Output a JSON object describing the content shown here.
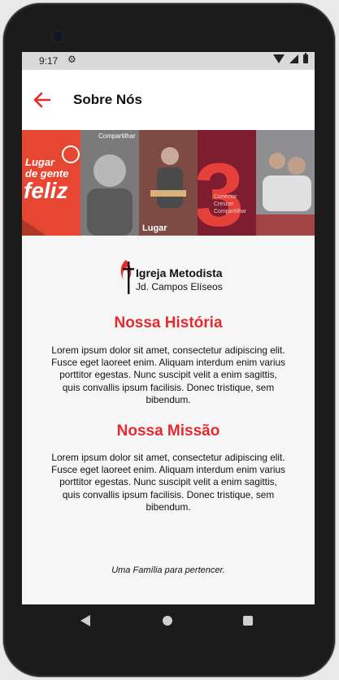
{
  "status_bar": {
    "time": "9:17",
    "settings_icon": "gear-icon"
  },
  "app_bar": {
    "title": "Sobre Nós",
    "back_icon": "arrow-left-icon",
    "accent": "#e62b2f"
  },
  "banner": {
    "texts": [
      "Lugar",
      "de gente",
      "feliz",
      "Compartilhar",
      "Conectar",
      "Crescer",
      "Compartilhar",
      "Lugar",
      "3"
    ]
  },
  "logo": {
    "line1": "Igreja Metodista",
    "line2": "Jd. Campos Elíseos"
  },
  "history": {
    "heading": "Nossa História",
    "text": "Lorem ipsum dolor sit amet, consectetur adipiscing elit. Fusce eget laoreet enim. Aliquam interdum enim varius porttitor egestas. Nunc suscipit velit a enim sagittis, quis convallis ipsum facilisis. Donec tristique, sem bibendum."
  },
  "mission": {
    "heading": "Nossa Missão",
    "text": "Lorem ipsum dolor sit amet, consectetur adipiscing elit. Fusce eget laoreet enim. Aliquam interdum enim varius porttitor egestas. Nunc suscipit velit a enim sagittis, quis convallis ipsum facilisis. Donec tristique, sem bibendum."
  },
  "footer": {
    "tagline": "Uma Família para pertencer."
  },
  "nav": {
    "back": "back-triangle-icon",
    "home": "home-circle-icon",
    "recent": "recent-square-icon"
  }
}
